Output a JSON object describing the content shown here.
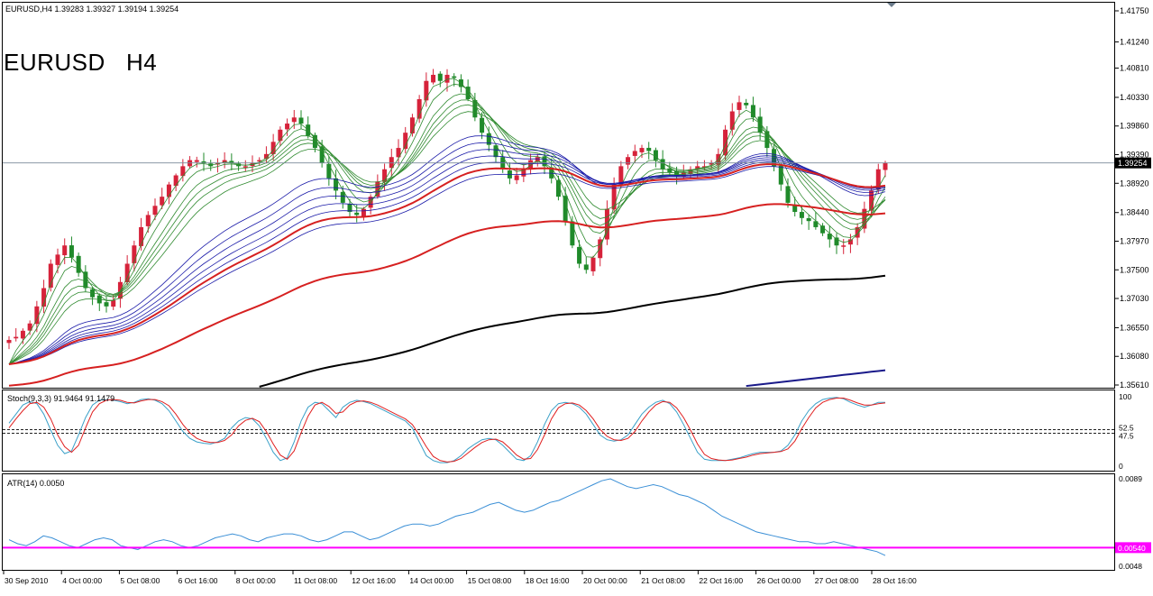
{
  "header": {
    "info": "EURUSD,H4  1.39283 1.39327 1.39194 1.39254",
    "big_title": "EURUSD   H4"
  },
  "colors": {
    "bull": "#d6223a",
    "bear": "#1f8a2a",
    "green_emas": "#2f8a2f",
    "blue_emas": "#1a1aa8",
    "red_ema": "#d62020",
    "black_ma": "#000000",
    "navy_ma": "#1a1a8a",
    "stoch_main": "#3aa0c8",
    "stoch_signal": "#e02020",
    "atr_line": "#3a8fd6",
    "atr_level": "#ff00ff",
    "price_line": "#7a8a9a"
  },
  "chart_data": [
    {
      "type": "candlestick",
      "title": "EURUSD,H4",
      "ylim": [
        1.3561,
        1.4175
      ],
      "price_axis_ticks": [
        "1.41750",
        "1.41240",
        "1.40810",
        "1.40330",
        "1.39860",
        "1.39390",
        "1.38920",
        "1.38440",
        "1.37970",
        "1.37500",
        "1.37030",
        "1.36550",
        "1.36080",
        "1.35610"
      ],
      "current_price": "1.39254",
      "last_bar": {
        "open": 1.39283,
        "high": 1.39327,
        "low": 1.39194,
        "close": 1.39254
      },
      "time_axis_labels": [
        "30 Sep 2010",
        "4 Oct 00:00",
        "5 Oct 08:00",
        "6 Oct 16:00",
        "8 Oct 00:00",
        "11 Oct 08:00",
        "12 Oct 16:00",
        "14 Oct 00:00",
        "15 Oct 08:00",
        "18 Oct 16:00",
        "20 Oct 00:00",
        "21 Oct 08:00",
        "22 Oct 16:00",
        "26 Oct 00:00",
        "27 Oct 08:00",
        "28 Oct 16:00"
      ],
      "close_path": [
        1.3635,
        1.364,
        1.365,
        1.3662,
        1.369,
        1.372,
        1.376,
        1.3775,
        1.379,
        1.377,
        1.3745,
        1.372,
        1.3705,
        1.3695,
        1.369,
        1.37,
        1.373,
        1.376,
        1.379,
        1.382,
        1.384,
        1.3855,
        1.387,
        1.389,
        1.3905,
        1.392,
        1.393,
        1.393,
        1.3925,
        1.392,
        1.3925,
        1.393,
        1.3925,
        1.392,
        1.392,
        1.3925,
        1.393,
        1.394,
        1.396,
        1.398,
        1.399,
        1.4,
        1.399,
        1.397,
        1.395,
        1.3925,
        1.39,
        1.388,
        1.386,
        1.3845,
        1.384,
        1.385,
        1.387,
        1.3895,
        1.3915,
        1.3935,
        1.395,
        1.3975,
        1.4,
        1.403,
        1.406,
        1.407,
        1.406,
        1.407,
        1.4065,
        1.405,
        1.403,
        1.4,
        1.3975,
        1.3955,
        1.3935,
        1.3915,
        1.39,
        1.3905,
        1.3915,
        1.393,
        1.3935,
        1.392,
        1.39,
        1.387,
        1.383,
        1.379,
        1.376,
        1.375,
        1.377,
        1.38,
        1.385,
        1.389,
        1.392,
        1.3935,
        1.3945,
        1.395,
        1.3945,
        1.393,
        1.3915,
        1.391,
        1.3905,
        1.391,
        1.3915,
        1.392,
        1.392,
        1.3925,
        1.394,
        1.398,
        1.401,
        1.4025,
        1.402,
        1.4,
        1.3975,
        1.395,
        1.392,
        1.389,
        1.386,
        1.3845,
        1.3835,
        1.383,
        1.382,
        1.381,
        1.38,
        1.379,
        1.379,
        1.38,
        1.382,
        1.385,
        1.388,
        1.3915,
        1.3925
      ]
    },
    {
      "type": "line",
      "title": "Stoch(9,3,3) 91.9464 91.1479",
      "ylim": [
        0,
        100
      ],
      "axis_labels": [
        "100",
        "52.5",
        "47.5",
        "0"
      ],
      "levels": [
        52.5,
        47.5
      ],
      "series": [
        {
          "name": "91.9464",
          "values": [
            62,
            75,
            88,
            93,
            90,
            75,
            52,
            30,
            18,
            22,
            45,
            70,
            88,
            95,
            96,
            95,
            93,
            90,
            92,
            96,
            97,
            95,
            90,
            80,
            65,
            50,
            40,
            35,
            33,
            32,
            35,
            40,
            55,
            65,
            70,
            68,
            58,
            40,
            20,
            8,
            12,
            35,
            65,
            85,
            92,
            90,
            80,
            70,
            85,
            92,
            95,
            93,
            90,
            85,
            80,
            75,
            70,
            65,
            55,
            35,
            15,
            8,
            5,
            5,
            8,
            15,
            25,
            32,
            38,
            40,
            38,
            30,
            20,
            10,
            8,
            15,
            35,
            60,
            80,
            90,
            92,
            90,
            85,
            75,
            60,
            45,
            38,
            36,
            38,
            45,
            60,
            75,
            85,
            92,
            95,
            90,
            78,
            60,
            40,
            20,
            10,
            8,
            8,
            8,
            10,
            12,
            15,
            18,
            20,
            20,
            20,
            22,
            30,
            45,
            65,
            80,
            90,
            96,
            98,
            99,
            97,
            92,
            88,
            85,
            88,
            92,
            92
          ]
        },
        {
          "name": "91.1479",
          "values": [
            55,
            68,
            80,
            90,
            92,
            85,
            68,
            45,
            28,
            20,
            30,
            55,
            78,
            90,
            95,
            96,
            95,
            92,
            91,
            94,
            96,
            96,
            93,
            87,
            75,
            60,
            48,
            40,
            36,
            34,
            34,
            37,
            45,
            58,
            66,
            69,
            64,
            50,
            32,
            16,
            10,
            22,
            48,
            72,
            88,
            92,
            86,
            76,
            78,
            88,
            93,
            94,
            92,
            88,
            83,
            78,
            73,
            68,
            60,
            45,
            28,
            14,
            8,
            6,
            7,
            11,
            19,
            27,
            34,
            38,
            39,
            35,
            26,
            16,
            10,
            11,
            24,
            45,
            68,
            84,
            90,
            91,
            88,
            80,
            68,
            53,
            43,
            38,
            37,
            40,
            50,
            65,
            78,
            88,
            93,
            92,
            84,
            70,
            52,
            32,
            17,
            11,
            9,
            8,
            9,
            11,
            13,
            16,
            18,
            19,
            20,
            21,
            25,
            36,
            54,
            70,
            84,
            92,
            96,
            98,
            98,
            95,
            91,
            88,
            88,
            90,
            91
          ]
        }
      ]
    },
    {
      "type": "line",
      "title": "ATR(14) 0.0050",
      "ylim": [
        0.0045,
        0.0089
      ],
      "axis_labels": [
        "0.0089",
        "0.00540",
        "0.0048"
      ],
      "level": 0.0054,
      "level_label": "0.00540",
      "series": [
        {
          "name": "0.0050",
          "values": [
            0.0058,
            0.0056,
            0.0055,
            0.0057,
            0.006,
            0.0059,
            0.0057,
            0.0055,
            0.0054,
            0.0056,
            0.0058,
            0.0059,
            0.0058,
            0.0055,
            0.0054,
            0.0053,
            0.0055,
            0.0057,
            0.0058,
            0.0057,
            0.0055,
            0.0054,
            0.0055,
            0.0057,
            0.0059,
            0.006,
            0.0061,
            0.006,
            0.0058,
            0.0057,
            0.0059,
            0.006,
            0.0061,
            0.0061,
            0.006,
            0.0058,
            0.0057,
            0.0058,
            0.006,
            0.0062,
            0.0062,
            0.006,
            0.0058,
            0.0059,
            0.0061,
            0.0063,
            0.0065,
            0.0066,
            0.0066,
            0.0065,
            0.0066,
            0.0068,
            0.007,
            0.0071,
            0.0072,
            0.0074,
            0.0076,
            0.0077,
            0.0075,
            0.0073,
            0.0072,
            0.0073,
            0.0075,
            0.0077,
            0.0078,
            0.008,
            0.0082,
            0.0084,
            0.0086,
            0.0088,
            0.0089,
            0.0087,
            0.0085,
            0.0084,
            0.0085,
            0.0086,
            0.0085,
            0.0083,
            0.0081,
            0.008,
            0.0078,
            0.0076,
            0.0073,
            0.007,
            0.0068,
            0.0066,
            0.0064,
            0.0062,
            0.0061,
            0.006,
            0.0059,
            0.0058,
            0.0057,
            0.0057,
            0.0056,
            0.0056,
            0.0057,
            0.0056,
            0.0055,
            0.0054,
            0.0053,
            0.0052,
            0.005
          ]
        }
      ]
    }
  ]
}
